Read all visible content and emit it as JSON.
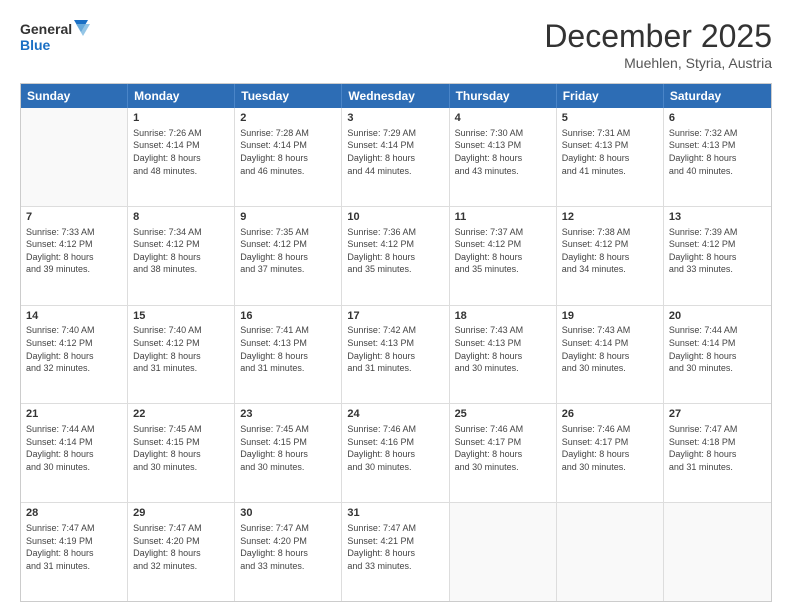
{
  "logo": {
    "line1": "General",
    "line2": "Blue"
  },
  "title": "December 2025",
  "location": "Muehlen, Styria, Austria",
  "dayHeaders": [
    "Sunday",
    "Monday",
    "Tuesday",
    "Wednesday",
    "Thursday",
    "Friday",
    "Saturday"
  ],
  "weeks": [
    [
      {
        "day": "",
        "info": ""
      },
      {
        "day": "1",
        "info": "Sunrise: 7:26 AM\nSunset: 4:14 PM\nDaylight: 8 hours\nand 48 minutes."
      },
      {
        "day": "2",
        "info": "Sunrise: 7:28 AM\nSunset: 4:14 PM\nDaylight: 8 hours\nand 46 minutes."
      },
      {
        "day": "3",
        "info": "Sunrise: 7:29 AM\nSunset: 4:14 PM\nDaylight: 8 hours\nand 44 minutes."
      },
      {
        "day": "4",
        "info": "Sunrise: 7:30 AM\nSunset: 4:13 PM\nDaylight: 8 hours\nand 43 minutes."
      },
      {
        "day": "5",
        "info": "Sunrise: 7:31 AM\nSunset: 4:13 PM\nDaylight: 8 hours\nand 41 minutes."
      },
      {
        "day": "6",
        "info": "Sunrise: 7:32 AM\nSunset: 4:13 PM\nDaylight: 8 hours\nand 40 minutes."
      }
    ],
    [
      {
        "day": "7",
        "info": "Sunrise: 7:33 AM\nSunset: 4:12 PM\nDaylight: 8 hours\nand 39 minutes."
      },
      {
        "day": "8",
        "info": "Sunrise: 7:34 AM\nSunset: 4:12 PM\nDaylight: 8 hours\nand 38 minutes."
      },
      {
        "day": "9",
        "info": "Sunrise: 7:35 AM\nSunset: 4:12 PM\nDaylight: 8 hours\nand 37 minutes."
      },
      {
        "day": "10",
        "info": "Sunrise: 7:36 AM\nSunset: 4:12 PM\nDaylight: 8 hours\nand 35 minutes."
      },
      {
        "day": "11",
        "info": "Sunrise: 7:37 AM\nSunset: 4:12 PM\nDaylight: 8 hours\nand 35 minutes."
      },
      {
        "day": "12",
        "info": "Sunrise: 7:38 AM\nSunset: 4:12 PM\nDaylight: 8 hours\nand 34 minutes."
      },
      {
        "day": "13",
        "info": "Sunrise: 7:39 AM\nSunset: 4:12 PM\nDaylight: 8 hours\nand 33 minutes."
      }
    ],
    [
      {
        "day": "14",
        "info": "Sunrise: 7:40 AM\nSunset: 4:12 PM\nDaylight: 8 hours\nand 32 minutes."
      },
      {
        "day": "15",
        "info": "Sunrise: 7:40 AM\nSunset: 4:12 PM\nDaylight: 8 hours\nand 31 minutes."
      },
      {
        "day": "16",
        "info": "Sunrise: 7:41 AM\nSunset: 4:13 PM\nDaylight: 8 hours\nand 31 minutes."
      },
      {
        "day": "17",
        "info": "Sunrise: 7:42 AM\nSunset: 4:13 PM\nDaylight: 8 hours\nand 31 minutes."
      },
      {
        "day": "18",
        "info": "Sunrise: 7:43 AM\nSunset: 4:13 PM\nDaylight: 8 hours\nand 30 minutes."
      },
      {
        "day": "19",
        "info": "Sunrise: 7:43 AM\nSunset: 4:14 PM\nDaylight: 8 hours\nand 30 minutes."
      },
      {
        "day": "20",
        "info": "Sunrise: 7:44 AM\nSunset: 4:14 PM\nDaylight: 8 hours\nand 30 minutes."
      }
    ],
    [
      {
        "day": "21",
        "info": "Sunrise: 7:44 AM\nSunset: 4:14 PM\nDaylight: 8 hours\nand 30 minutes."
      },
      {
        "day": "22",
        "info": "Sunrise: 7:45 AM\nSunset: 4:15 PM\nDaylight: 8 hours\nand 30 minutes."
      },
      {
        "day": "23",
        "info": "Sunrise: 7:45 AM\nSunset: 4:15 PM\nDaylight: 8 hours\nand 30 minutes."
      },
      {
        "day": "24",
        "info": "Sunrise: 7:46 AM\nSunset: 4:16 PM\nDaylight: 8 hours\nand 30 minutes."
      },
      {
        "day": "25",
        "info": "Sunrise: 7:46 AM\nSunset: 4:17 PM\nDaylight: 8 hours\nand 30 minutes."
      },
      {
        "day": "26",
        "info": "Sunrise: 7:46 AM\nSunset: 4:17 PM\nDaylight: 8 hours\nand 30 minutes."
      },
      {
        "day": "27",
        "info": "Sunrise: 7:47 AM\nSunset: 4:18 PM\nDaylight: 8 hours\nand 31 minutes."
      }
    ],
    [
      {
        "day": "28",
        "info": "Sunrise: 7:47 AM\nSunset: 4:19 PM\nDaylight: 8 hours\nand 31 minutes."
      },
      {
        "day": "29",
        "info": "Sunrise: 7:47 AM\nSunset: 4:20 PM\nDaylight: 8 hours\nand 32 minutes."
      },
      {
        "day": "30",
        "info": "Sunrise: 7:47 AM\nSunset: 4:20 PM\nDaylight: 8 hours\nand 33 minutes."
      },
      {
        "day": "31",
        "info": "Sunrise: 7:47 AM\nSunset: 4:21 PM\nDaylight: 8 hours\nand 33 minutes."
      },
      {
        "day": "",
        "info": ""
      },
      {
        "day": "",
        "info": ""
      },
      {
        "day": "",
        "info": ""
      }
    ]
  ]
}
